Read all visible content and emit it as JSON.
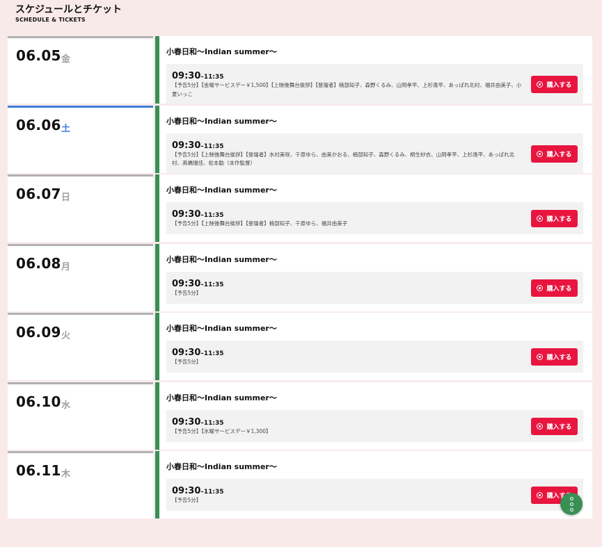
{
  "header": {
    "title": "スケジュールとチケット",
    "subtitle": "SCHEDULE & TICKETS"
  },
  "colors": {
    "accent_green": "#3a8f55",
    "buy_red": "#e8153f",
    "saturday_blue": "#3f7ed6",
    "background_pink": "#f9eaea"
  },
  "buy_label": "購入する",
  "days": [
    {
      "date": "06.05",
      "weekday": "金",
      "saturday": false,
      "title": "小春日和〜Indian summer〜",
      "start": "09:30",
      "sep": "–",
      "end": "11:35",
      "desc": "【予告5分】【金曜サービスデー￥1,500】【上映後舞台挨拶】【登壇者】楠部知子、森野くるみ、山岡孝平、上杉逸平、あっぱれ北村、福井由美子、小夏いっこ"
    },
    {
      "date": "06.06",
      "weekday": "土",
      "saturday": true,
      "title": "小春日和〜Indian summer〜",
      "start": "09:30",
      "sep": "–",
      "end": "11:35",
      "desc": "【予告5分】【上映後舞台挨拶】【登壇者】水村美咲、千原ゆら、由美かおる、楠部知子、森野くるみ、桐生紗衣、山岡孝平、上杉逸平、あっぱれ北村、髙橋瑞佳、松本勧（本作監督）"
    },
    {
      "date": "06.07",
      "weekday": "日",
      "saturday": false,
      "title": "小春日和〜Indian summer〜",
      "start": "09:30",
      "sep": "–",
      "end": "11:35",
      "desc": "【予告5分】【上映後舞台挨拶】【登壇者】楠部知子、千原ゆら、福井由美子"
    },
    {
      "date": "06.08",
      "weekday": "月",
      "saturday": false,
      "title": "小春日和〜Indian summer〜",
      "start": "09:30",
      "sep": "–",
      "end": "11:35",
      "desc": "【予告5分】"
    },
    {
      "date": "06.09",
      "weekday": "火",
      "saturday": false,
      "title": "小春日和〜Indian summer〜",
      "start": "09:30",
      "sep": "–",
      "end": "11:35",
      "desc": "【予告5分】"
    },
    {
      "date": "06.10",
      "weekday": "水",
      "saturday": false,
      "title": "小春日和〜Indian summer〜",
      "start": "09:30",
      "sep": "–",
      "end": "11:35",
      "desc": "【予告5分】【水曜サービスデー￥1,300】"
    },
    {
      "date": "06.11",
      "weekday": "木",
      "saturday": false,
      "title": "小春日和〜Indian summer〜",
      "start": "09:30",
      "sep": "–",
      "end": "11:35",
      "desc": "【予告5分】"
    }
  ]
}
